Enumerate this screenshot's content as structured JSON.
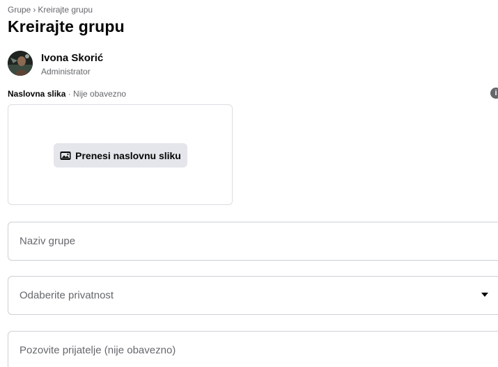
{
  "breadcrumb": {
    "parent": "Grupe",
    "separator": "›",
    "current": "Kreirajte grupu"
  },
  "page_title": "Kreirajte grupu",
  "user": {
    "name": "Ivona Skorić",
    "role": "Administrator"
  },
  "cover": {
    "label": "Naslovna slika",
    "optional_text": " · Nije obavezno",
    "upload_label": "Prenesi naslovnu sliku",
    "upload_icon": "photo-icon",
    "info_icon": "info-icon"
  },
  "form": {
    "name_placeholder": "Naziv grupe",
    "privacy_placeholder": "Odaberite privatnost",
    "privacy_icon": "dropdown-caret-icon",
    "friends_placeholder": "Pozovite prijatelje (nije obavezno)"
  },
  "colors": {
    "text_primary": "#050505",
    "text_secondary": "#65676b",
    "button_bg": "#e4e6eb",
    "border": "#ccd0d5"
  }
}
